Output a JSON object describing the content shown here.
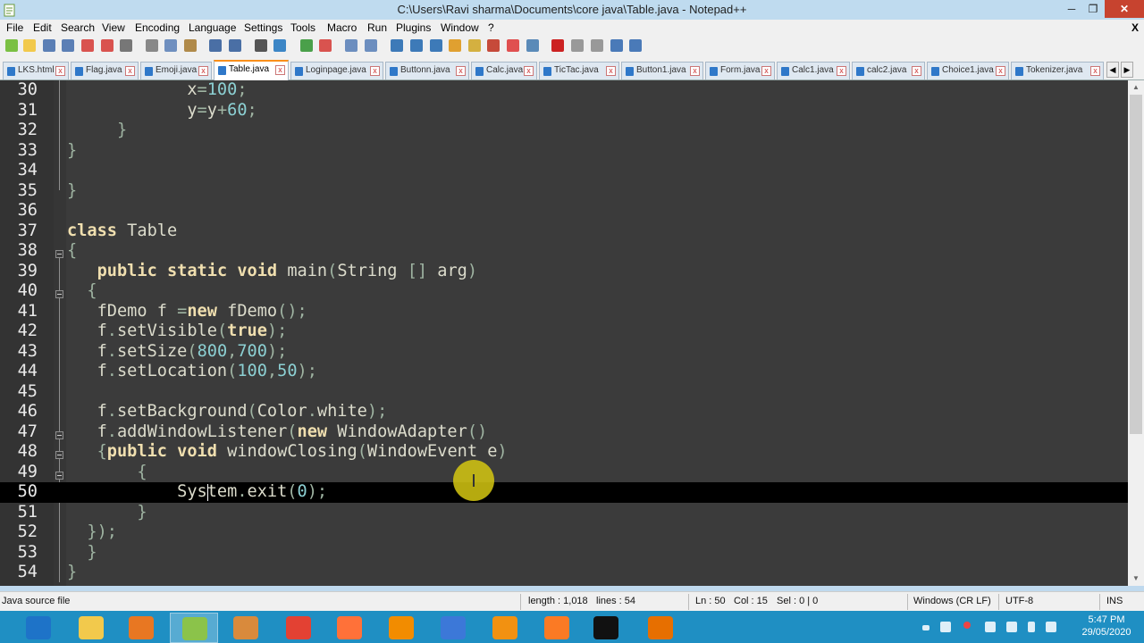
{
  "window": {
    "title": "C:\\Users\\Ravi sharma\\Documents\\core java\\Table.java - Notepad++",
    "minimize": "─",
    "maximize": "❐",
    "close": "✕"
  },
  "menu": [
    "File",
    "Edit",
    "Search",
    "View",
    "Encoding",
    "Language",
    "Settings",
    "Tools",
    "Macro",
    "Run",
    "Plugins",
    "Window",
    "?"
  ],
  "menu_close": "X",
  "tabs": [
    {
      "label": "LKS.html",
      "active": false
    },
    {
      "label": "Flag.java",
      "active": false
    },
    {
      "label": "Emoji.java",
      "active": false
    },
    {
      "label": "Table.java",
      "active": true
    },
    {
      "label": "Loginpage.java",
      "active": false
    },
    {
      "label": "Buttonn.java",
      "active": false
    },
    {
      "label": "Calc.java",
      "active": false
    },
    {
      "label": "TicTac.java",
      "active": false
    },
    {
      "label": "Button1.java",
      "active": false
    },
    {
      "label": "Form.java",
      "active": false
    },
    {
      "label": "Calc1.java",
      "active": false
    },
    {
      "label": "calc2.java",
      "active": false
    },
    {
      "label": "Choice1.java",
      "active": false
    },
    {
      "label": "Tokenizer.java",
      "active": false
    }
  ],
  "editor": {
    "current_line": 50,
    "lines": [
      {
        "n": "30",
        "text": "            x=100;"
      },
      {
        "n": "31",
        "text": "            y=y+60;"
      },
      {
        "n": "32",
        "text": "     }"
      },
      {
        "n": "33",
        "text": "}"
      },
      {
        "n": "34",
        "text": ""
      },
      {
        "n": "35",
        "text": "}"
      },
      {
        "n": "36",
        "text": ""
      },
      {
        "n": "37",
        "text": "class Table"
      },
      {
        "n": "38",
        "text": "{"
      },
      {
        "n": "39",
        "text": "   public static void main(String [] arg)"
      },
      {
        "n": "40",
        "text": "  {"
      },
      {
        "n": "41",
        "text": "   fDemo f =new fDemo();"
      },
      {
        "n": "42",
        "text": "   f.setVisible(true);"
      },
      {
        "n": "43",
        "text": "   f.setSize(800,700);"
      },
      {
        "n": "44",
        "text": "   f.setLocation(100,50);"
      },
      {
        "n": "45",
        "text": ""
      },
      {
        "n": "46",
        "text": "   f.setBackground(Color.white);"
      },
      {
        "n": "47",
        "text": "   f.addWindowListener(new WindowAdapter()"
      },
      {
        "n": "48",
        "text": "   {public void windowClosing(WindowEvent e)"
      },
      {
        "n": "49",
        "text": "       {"
      },
      {
        "n": "50",
        "text": "           System.exit(0);"
      },
      {
        "n": "51",
        "text": "       }"
      },
      {
        "n": "52",
        "text": "  });"
      },
      {
        "n": "53",
        "text": "  }"
      },
      {
        "n": "54",
        "text": "}"
      }
    ]
  },
  "status": {
    "filetype": "Java source file",
    "length": "length : 1,018",
    "lines": "lines : 54",
    "ln": "Ln : 50",
    "col": "Col : 15",
    "sel": "Sel : 0 | 0",
    "eol": "Windows (CR LF)",
    "encoding": "UTF-8",
    "mode": "INS"
  },
  "taskbar": {
    "apps": [
      {
        "name": "internet-explorer",
        "color": "#1e73c8"
      },
      {
        "name": "file-explorer",
        "color": "#f2c94c"
      },
      {
        "name": "installer",
        "color": "#e87722"
      },
      {
        "name": "notepad-plus-plus",
        "color": "#8bc34a"
      },
      {
        "name": "tool-app",
        "color": "#d98a3c"
      },
      {
        "name": "chrome",
        "color": "#e34133"
      },
      {
        "name": "firefox",
        "color": "#ff7139"
      },
      {
        "name": "vlc",
        "color": "#f28c00"
      },
      {
        "name": "network-app",
        "color": "#3c78d8"
      },
      {
        "name": "sublime-text",
        "color": "#f29111"
      },
      {
        "name": "xampp",
        "color": "#fb7a24"
      },
      {
        "name": "command-prompt",
        "color": "#111111"
      },
      {
        "name": "java",
        "color": "#e76f00"
      }
    ],
    "time": "5:47 PM",
    "date": "29/05/2020"
  },
  "colors": {
    "editor_bg": "#3b3b3b",
    "keyword": "#f0dfaf",
    "number": "#8cd0d3",
    "active_tab_accent": "#fa8f1a",
    "taskbar": "#1f8fc3"
  }
}
